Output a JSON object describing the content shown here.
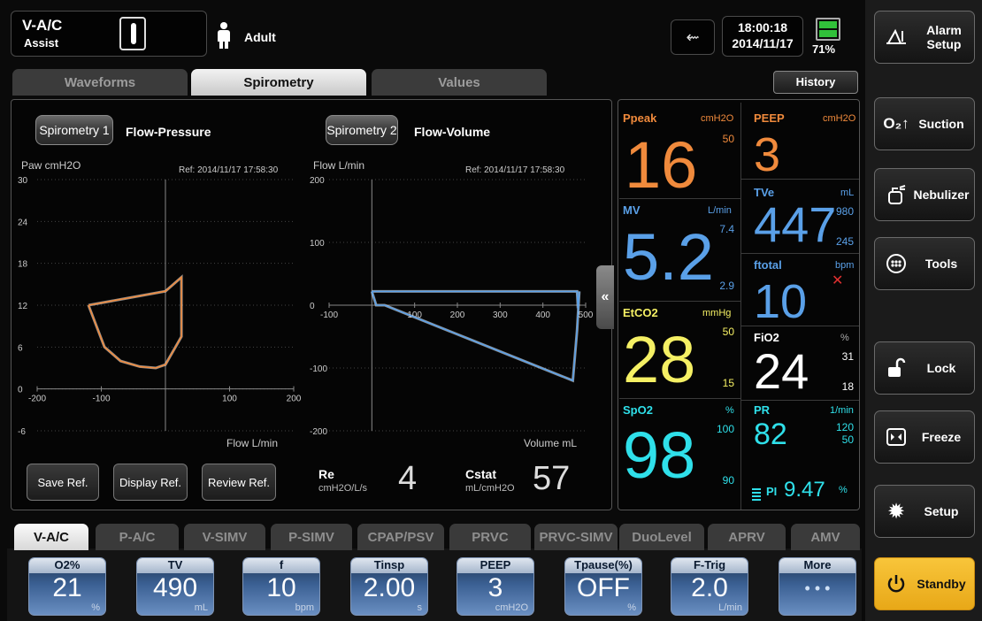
{
  "header": {
    "mode": "V-A/C",
    "trigger": "Assist",
    "patient": "Adult",
    "time": "18:00:18",
    "date": "2014/11/17",
    "battery": "71%"
  },
  "tabs": [
    {
      "label": "Waveforms",
      "active": false
    },
    {
      "label": "Spirometry",
      "active": true
    },
    {
      "label": "Values",
      "active": false
    }
  ],
  "history_label": "History",
  "spiro1": {
    "button": "Spirometry 1",
    "type": "Flow-Pressure",
    "ylabel": "Paw cmH2O",
    "ref": "Ref: 2014/11/17 17:58:30",
    "xlabel": "Flow L/min",
    "y_ticks": [
      "30",
      "24",
      "18",
      "12",
      "6",
      "0",
      "-6"
    ],
    "x_ticks": [
      "-200",
      "-100",
      "100",
      "200"
    ]
  },
  "spiro2": {
    "button": "Spirometry 2",
    "type": "Flow-Volume",
    "ylabel": "Flow L/min",
    "ref": "Ref: 2014/11/17 17:58:30",
    "xlabel": "Volume mL",
    "y_ticks": [
      "200",
      "100",
      "0",
      "-100",
      "-200"
    ],
    "x_ticks": [
      "-100",
      "100",
      "200",
      "300",
      "400",
      "500"
    ]
  },
  "ref_buttons": [
    "Save Ref.",
    "Display Ref.",
    "Review Ref."
  ],
  "re": {
    "label": "Re",
    "unit": "cmH2O/L/s",
    "value": "4"
  },
  "cstat": {
    "label": "Cstat",
    "unit": "mL/cmH2O",
    "value": "57"
  },
  "collapse_icon": "double-chevron-left-icon",
  "monitor": {
    "ppeak": {
      "label": "Ppeak",
      "unit": "cmH2O",
      "value": "16",
      "high": "50",
      "color": "#f08a3c"
    },
    "peep": {
      "label": "PEEP",
      "unit": "cmH2O",
      "value": "3",
      "color": "#f08a3c"
    },
    "mv": {
      "label": "MV",
      "unit": "L/min",
      "value": "5.2",
      "high": "7.4",
      "low": "2.9",
      "color": "#5aa0e8"
    },
    "tve": {
      "label": "TVe",
      "unit": "mL",
      "value": "447",
      "high": "980",
      "low": "245",
      "color": "#5aa0e8"
    },
    "ftotal": {
      "label": "ftotal",
      "unit": "bpm",
      "value": "10",
      "color": "#5aa0e8"
    },
    "etco2": {
      "label": "EtCO2",
      "unit": "mmHg",
      "value": "28",
      "high": "50",
      "low": "15",
      "color": "#f5f064"
    },
    "fio2": {
      "label": "FiO2",
      "unit": "%",
      "value": "24",
      "high": "31",
      "low": "18",
      "color": "#ffffff"
    },
    "spo2": {
      "label": "SpO2",
      "unit": "%",
      "value": "98",
      "high": "100",
      "low": "90",
      "color": "#2fe0ea"
    },
    "pr": {
      "label": "PR",
      "unit": "1/min",
      "value": "82",
      "high": "120",
      "low": "50",
      "color": "#2fe0ea"
    },
    "pi": {
      "label": "PI",
      "value": "9.47",
      "unit": "%"
    }
  },
  "side": [
    "Alarm Setup",
    "Suction",
    "Nebulizer",
    "Tools",
    "Lock",
    "Freeze",
    "Setup",
    "Standby"
  ],
  "modes": [
    "V-A/C",
    "P-A/C",
    "V-SIMV",
    "P-SIMV",
    "CPAP/PSV",
    "PRVC",
    "PRVC-SIMV",
    "DuoLevel",
    "APRV",
    "AMV"
  ],
  "params": [
    {
      "label": "O2%",
      "value": "21",
      "unit": "%"
    },
    {
      "label": "TV",
      "value": "490",
      "unit": "mL"
    },
    {
      "label": "f",
      "value": "10",
      "unit": "bpm"
    },
    {
      "label": "Tinsp",
      "value": "2.00",
      "unit": "s"
    },
    {
      "label": "PEEP",
      "value": "3",
      "unit": "cmH2O"
    },
    {
      "label": "Tpause(%)",
      "value": "OFF",
      "unit": "%"
    },
    {
      "label": "F-Trig",
      "value": "2.0",
      "unit": "L/min"
    },
    {
      "label": "More",
      "value": "• • •",
      "unit": ""
    }
  ],
  "colors": {
    "orange": "#f08a3c",
    "blue": "#5aa0e8",
    "yellow": "#f5f064",
    "cyan": "#2fe0ea",
    "standby": "#f3b51c"
  },
  "chart_data": [
    {
      "type": "line",
      "title": "Flow-Pressure",
      "xlabel": "Flow L/min",
      "ylabel": "Paw cmH2O",
      "xlim": [
        -200,
        200
      ],
      "ylim": [
        -6,
        30
      ],
      "series": [
        {
          "name": "",
          "points": [
            [
              -120,
              12
            ],
            [
              -60,
              13
            ],
            [
              0,
              14
            ],
            [
              25,
              16
            ],
            [
              25,
              7.5
            ],
            [
              0,
              3.5
            ],
            [
              -15,
              3
            ],
            [
              -40,
              3.2
            ],
            [
              -70,
              4
            ],
            [
              -95,
              6
            ],
            [
              -120,
              12
            ]
          ]
        }
      ]
    },
    {
      "type": "line",
      "title": "Flow-Volume",
      "xlabel": "Volume mL",
      "ylabel": "Flow L/min",
      "xlim": [
        -100,
        500
      ],
      "ylim": [
        -200,
        200
      ],
      "series": [
        {
          "name": "",
          "points": [
            [
              0,
              22
            ],
            [
              480,
              22
            ],
            [
              482,
              -5
            ],
            [
              485,
              22
            ],
            [
              480,
              -40
            ],
            [
              470,
              -120
            ],
            [
              30,
              0
            ],
            [
              10,
              0
            ],
            [
              0,
              22
            ]
          ]
        }
      ]
    }
  ]
}
